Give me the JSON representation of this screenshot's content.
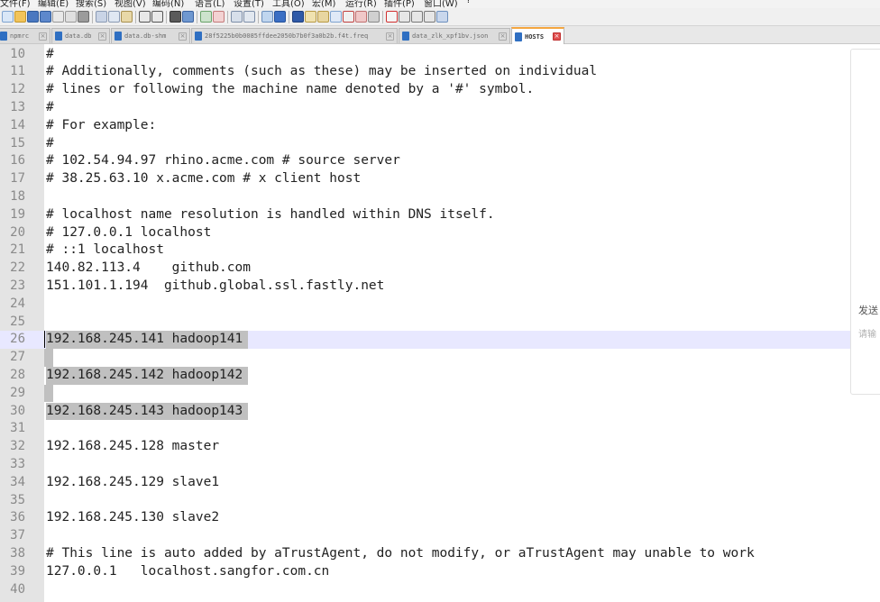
{
  "menu": {
    "items": [
      "文件(F)",
      "编辑(E)",
      "搜索(S)",
      "视图(V)",
      "编码(N)",
      "语言(L)",
      "设置(T)",
      "工具(O)",
      "宏(M)",
      "运行(R)",
      "插件(P)",
      "窗口(W)",
      "?"
    ]
  },
  "tabs": [
    {
      "label": "npmrc",
      "active": false
    },
    {
      "label": "data.db",
      "active": false
    },
    {
      "label": "data.db-shm",
      "active": false
    },
    {
      "label": "28f5225b0b0085ffdee2050b7b0f3a0b2b.f4t.freq",
      "active": false
    },
    {
      "label": "data_zlk_xpf1bv.json",
      "active": false
    },
    {
      "label": "HOSTS",
      "active": true
    }
  ],
  "editor": {
    "current_line": 26,
    "lines": [
      {
        "n": "10",
        "text": "#"
      },
      {
        "n": "11",
        "text": "# Additionally, comments (such as these) may be inserted on individual"
      },
      {
        "n": "12",
        "text": "# lines or following the machine name denoted by a '#' symbol."
      },
      {
        "n": "13",
        "text": "#"
      },
      {
        "n": "14",
        "text": "# For example:"
      },
      {
        "n": "15",
        "text": "#"
      },
      {
        "n": "16",
        "text": "# 102.54.94.97 rhino.acme.com # source server"
      },
      {
        "n": "17",
        "text": "# 38.25.63.10 x.acme.com # x client host"
      },
      {
        "n": "18",
        "text": ""
      },
      {
        "n": "19",
        "text": "# localhost name resolution is handled within DNS itself."
      },
      {
        "n": "20",
        "text": "# 127.0.0.1 localhost"
      },
      {
        "n": "21",
        "text": "# ::1 localhost"
      },
      {
        "n": "22",
        "text": "140.82.113.4    github.com"
      },
      {
        "n": "23",
        "text": "151.101.1.194  github.global.ssl.fastly.net"
      },
      {
        "n": "24",
        "text": ""
      },
      {
        "n": "25",
        "text": ""
      },
      {
        "n": "26",
        "text": "192.168.245.141 hadoop141"
      },
      {
        "n": "27",
        "text": ""
      },
      {
        "n": "28",
        "text": "192.168.245.142 hadoop142"
      },
      {
        "n": "29",
        "text": ""
      },
      {
        "n": "30",
        "text": "192.168.245.143 hadoop143"
      },
      {
        "n": "31",
        "text": ""
      },
      {
        "n": "32",
        "text": "192.168.245.128 master"
      },
      {
        "n": "33",
        "text": ""
      },
      {
        "n": "34",
        "text": "192.168.245.129 slave1"
      },
      {
        "n": "35",
        "text": ""
      },
      {
        "n": "36",
        "text": "192.168.245.130 slave2"
      },
      {
        "n": "37",
        "text": ""
      },
      {
        "n": "38",
        "text": "# This line is auto added by aTrustAgent, do not modify, or aTrustAgent may unable to work"
      },
      {
        "n": "39",
        "text": "127.0.0.1   localhost.sangfor.com.cn"
      },
      {
        "n": "40",
        "text": ""
      }
    ]
  },
  "side_panel": {
    "send_label": "发送",
    "input_hint": "请输"
  },
  "colors": {
    "gutter_bg": "#e4e4e4",
    "selection_bg": "#c0c0c0",
    "current_line_bg": "#e8e8ff",
    "active_tab_accent": "#f4a640",
    "file_icon_blue": "#2f6fc2",
    "tab_close_red": "#e05050"
  }
}
